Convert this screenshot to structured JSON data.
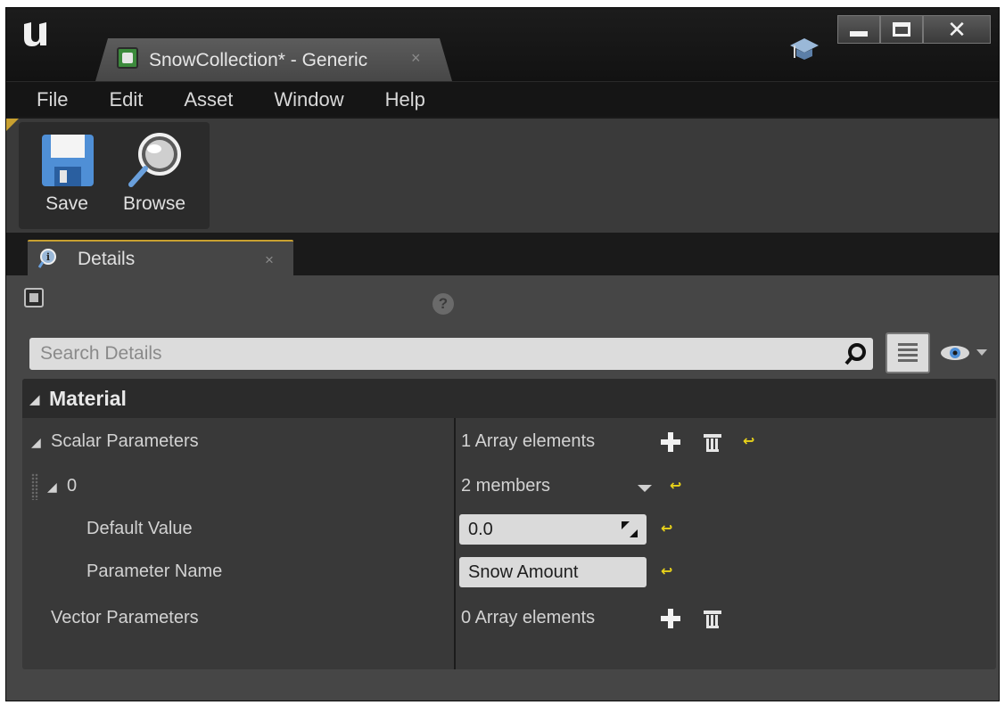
{
  "window": {
    "tab_title": "SnowCollection* - Generic",
    "tab_close": "×",
    "accent": "#c8a030",
    "background": "#464646"
  },
  "menu": [
    "File",
    "Edit",
    "Asset",
    "Window",
    "Help"
  ],
  "toolbar": {
    "save_label": "Save",
    "browse_label": "Browse"
  },
  "details_tab": {
    "label": "Details",
    "close": "×"
  },
  "search": {
    "placeholder": "Search Details"
  },
  "category": {
    "label": "Material",
    "arrow": "◢"
  },
  "properties": {
    "scalar": {
      "arrow": "◢",
      "name": "Scalar Parameters",
      "value": "1 Array elements"
    },
    "element0": {
      "arrow": "◢",
      "name": "0",
      "value": "2 members"
    },
    "default_value": {
      "name": "Default Value",
      "value": "0.0"
    },
    "parameter_name": {
      "name": "Parameter Name",
      "value": "Snow Amount"
    },
    "vector": {
      "name": "Vector Parameters",
      "value": "0 Array elements"
    }
  },
  "icons": {
    "reset_color": "#e8d21a",
    "reset_glyph": "↩"
  }
}
